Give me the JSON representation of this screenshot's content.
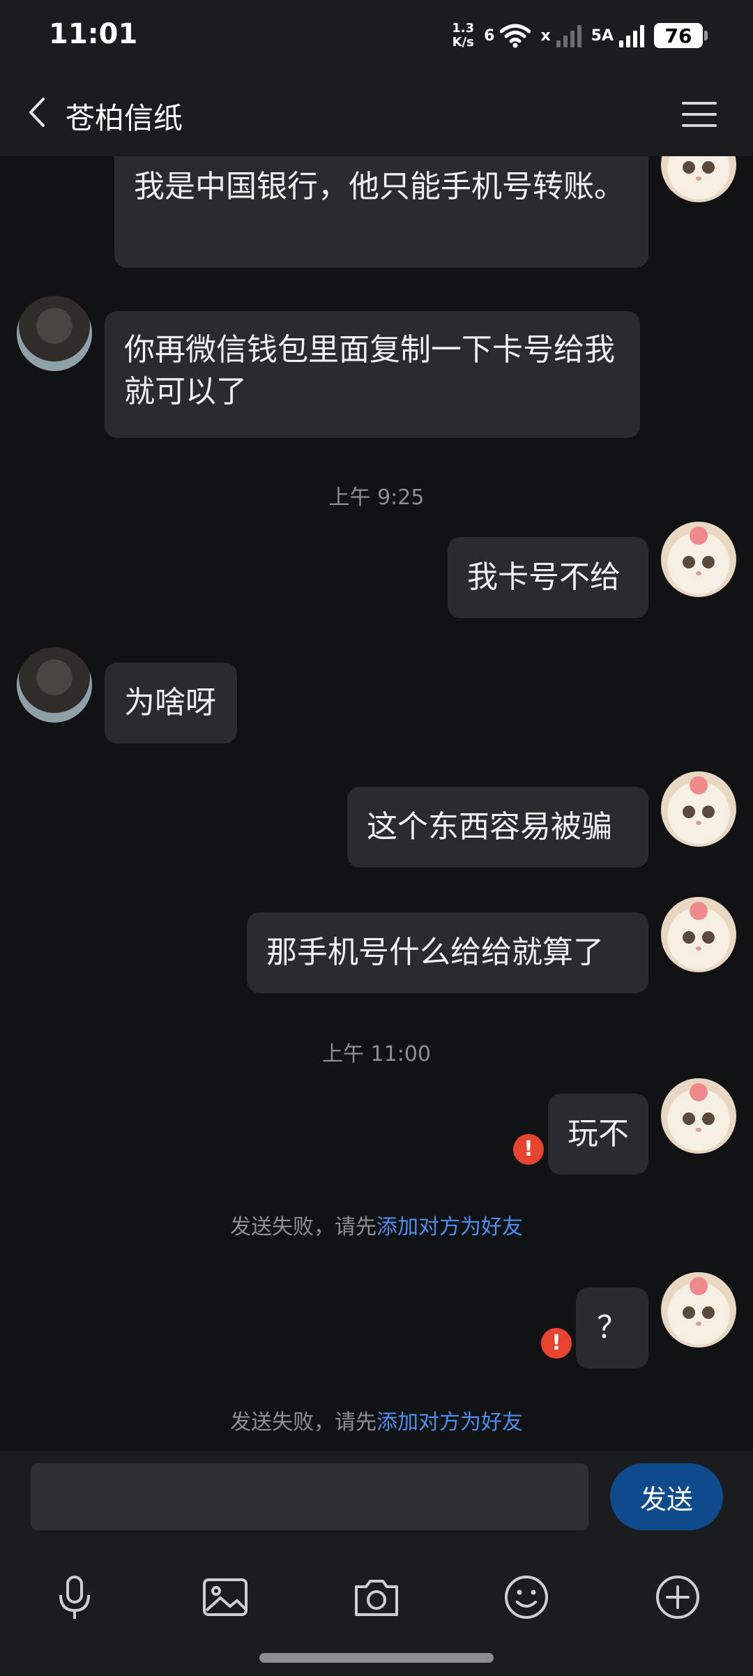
{
  "status_bar": {
    "time": "11:01",
    "net_speed_value": "1.3",
    "net_speed_unit": "K/s",
    "wifi_badge": "6",
    "cell_badge": "x",
    "network_type": "5A",
    "battery_level": "76"
  },
  "header": {
    "title": "苍柏信纸"
  },
  "messages": [
    {
      "side": "self",
      "text": "我是中国银行，他只能手机号转账。"
    },
    {
      "side": "other",
      "text": "你再微信钱包里面复制一下卡号给我就可以了"
    },
    {
      "side": "self",
      "text": "我卡号不给"
    },
    {
      "side": "other",
      "text": "为啥呀"
    },
    {
      "side": "self",
      "text": "这个东西容易被骗"
    },
    {
      "side": "self",
      "text": "那手机号什么给给就算了"
    },
    {
      "side": "self",
      "text": "玩不",
      "failed": true
    },
    {
      "side": "self",
      "text": "？",
      "failed": true
    }
  ],
  "time_labels": [
    "上午 9:25",
    "上午 11:00"
  ],
  "fail_notice": {
    "prefix": "发送失败，请先",
    "link": "添加对方为好友"
  },
  "input": {
    "value": "",
    "send_label": "发送"
  },
  "toolbar": [
    "microphone-icon",
    "image-icon",
    "camera-icon",
    "emoji-icon",
    "plus-icon"
  ],
  "colors": {
    "background": "#111214",
    "bubble": "#2a2b2e",
    "link": "#4d8ef0",
    "send_button": "#0f4a8c",
    "error": "#e8432f"
  }
}
